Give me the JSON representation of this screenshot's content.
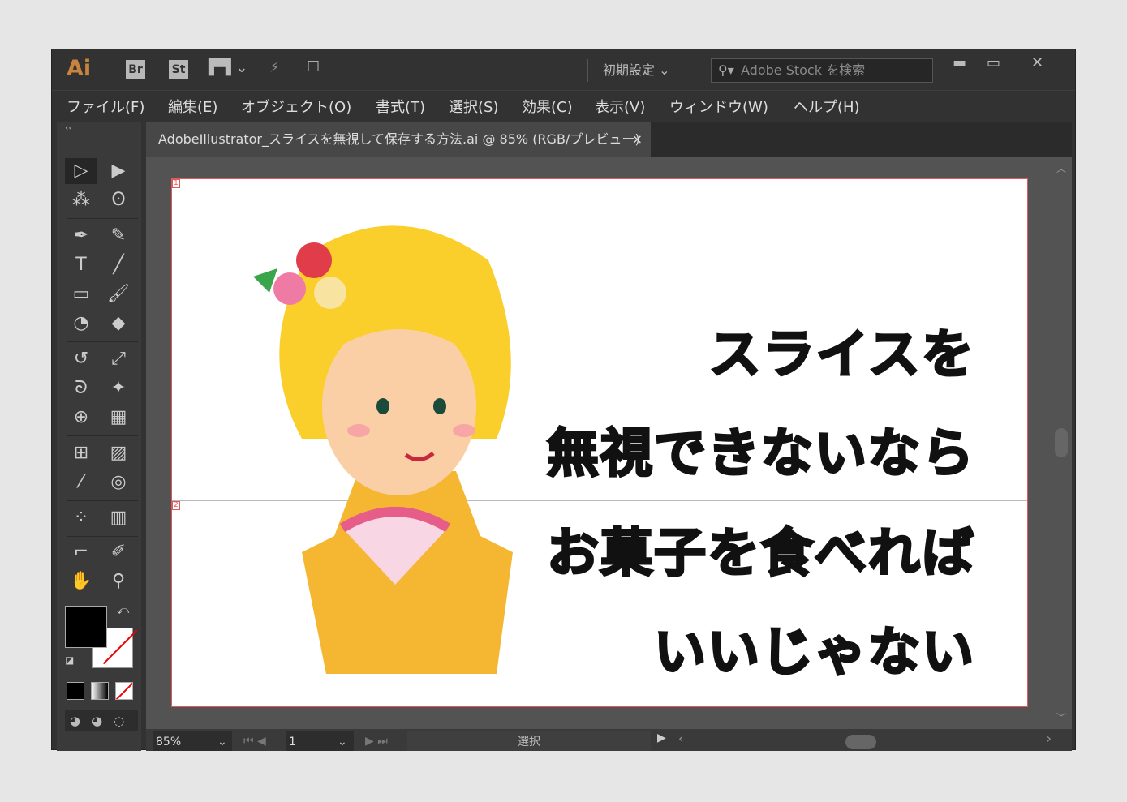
{
  "app": {
    "logo": "Ai",
    "bridge": "Br",
    "stock": "St",
    "workspace": "初期設定",
    "search_placeholder": "Adobe Stock を検索"
  },
  "menu": [
    "ファイル(F)",
    "編集(E)",
    "オブジェクト(O)",
    "書式(T)",
    "選択(S)",
    "効果(C)",
    "表示(V)",
    "ウィンドウ(W)",
    "ヘルプ(H)"
  ],
  "document": {
    "tab_title": "AdobeIllustrator_スライスを無視して保存する方法.ai @ 85% (RGB/プレビュー)",
    "close": "×"
  },
  "artboard": {
    "lines": [
      "スライスを",
      "無視できないなら",
      "お菓子を食べれば",
      "いいじゃない"
    ],
    "slice_labels": [
      "1",
      "2"
    ]
  },
  "status": {
    "zoom": "85%",
    "page": "1",
    "tool_label": "選択"
  },
  "colors": {
    "accent": "#c8843e",
    "slice": "#e05a5a"
  }
}
